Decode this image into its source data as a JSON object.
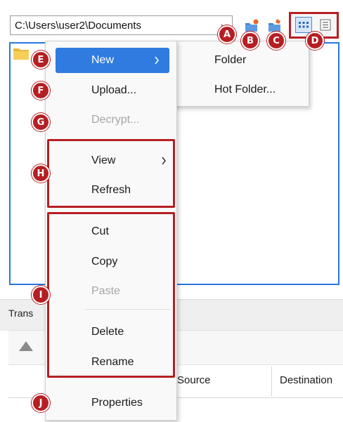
{
  "path": {
    "value": "C:\\Users\\user2\\Documents"
  },
  "icons": {
    "dropdown": "chevron-down-icon",
    "new_folder": "new-folder-icon",
    "new_hot_folder": "new-hot-folder-icon",
    "icon_view": "icon-view-icon",
    "list_view": "list-view-icon",
    "folder": "folder-icon",
    "upload_arrow": "up-arrow-icon"
  },
  "view_buttons": {
    "active": "icon-view"
  },
  "context_menu": {
    "items": [
      {
        "label": "New",
        "has_submenu": true,
        "highlighted": true,
        "disabled": false
      },
      {
        "label": "Upload...",
        "disabled": false
      },
      {
        "label": "Decrypt...",
        "disabled": true
      },
      {
        "label": "View",
        "has_submenu": true,
        "disabled": false
      },
      {
        "label": "Refresh",
        "disabled": false
      },
      {
        "label": "Cut",
        "disabled": false
      },
      {
        "label": "Copy",
        "disabled": false
      },
      {
        "label": "Paste",
        "disabled": true
      },
      {
        "label": "Delete",
        "disabled": false
      },
      {
        "label": "Rename",
        "disabled": false
      },
      {
        "label": "Properties",
        "disabled": false
      }
    ]
  },
  "submenu": {
    "items": [
      {
        "label": "Folder"
      },
      {
        "label": "Hot Folder..."
      }
    ]
  },
  "callouts": [
    "A",
    "B",
    "C",
    "D",
    "E",
    "F",
    "G",
    "H",
    "I",
    "J"
  ],
  "transfers": {
    "tab_label": "Trans",
    "columns": [
      "Source",
      "Destination"
    ]
  },
  "colors": {
    "accent": "#2f7be0",
    "callout_red": "#b51f23",
    "area_border": "#2878e0"
  }
}
